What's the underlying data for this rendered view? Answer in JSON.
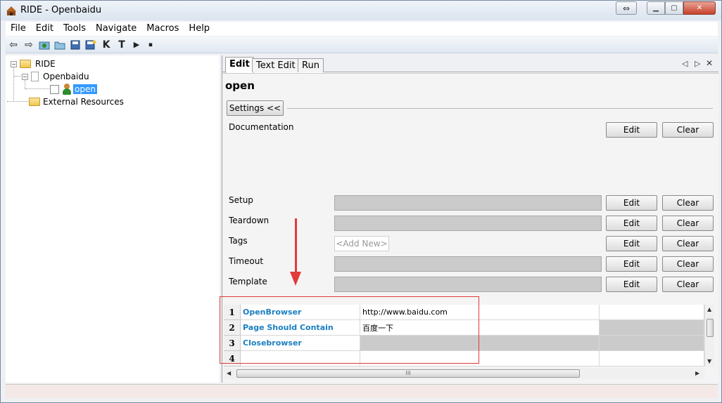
{
  "window": {
    "title": "RIDE - Openbaidu"
  },
  "menu": [
    "File",
    "Edit",
    "Tools",
    "Navigate",
    "Macros",
    "Help"
  ],
  "toolbar": {
    "k_label": "K",
    "t_label": "T"
  },
  "tree": {
    "root": "RIDE",
    "suite": "Openbaidu",
    "keyword": "open",
    "external": "External Resources"
  },
  "tabs": [
    "Edit",
    "Text Edit",
    "Run"
  ],
  "editor": {
    "keyword_name": "open",
    "settings_button": "Settings <<",
    "documentation_label": "Documentation",
    "setup_label": "Setup",
    "teardown_label": "Teardown",
    "tags_label": "Tags",
    "timeout_label": "Timeout",
    "template_label": "Template",
    "add_new_placeholder": "<Add New>",
    "edit_button": "Edit",
    "clear_button": "Clear"
  },
  "grid": {
    "rows": [
      {
        "num": "1",
        "keyword": "OpenBrowser",
        "arg": "http://www.baidu.com"
      },
      {
        "num": "2",
        "keyword": "Page Should Contain",
        "arg": "百度一下"
      },
      {
        "num": "3",
        "keyword": "Closebrowser",
        "arg": ""
      },
      {
        "num": "4",
        "keyword": "",
        "arg": ""
      }
    ]
  },
  "scroll": {
    "grip": "III"
  },
  "colors": {
    "keyword_blue": "#1a7fc1",
    "annotation_red": "#e23b3b",
    "selection_blue": "#3399ff"
  }
}
